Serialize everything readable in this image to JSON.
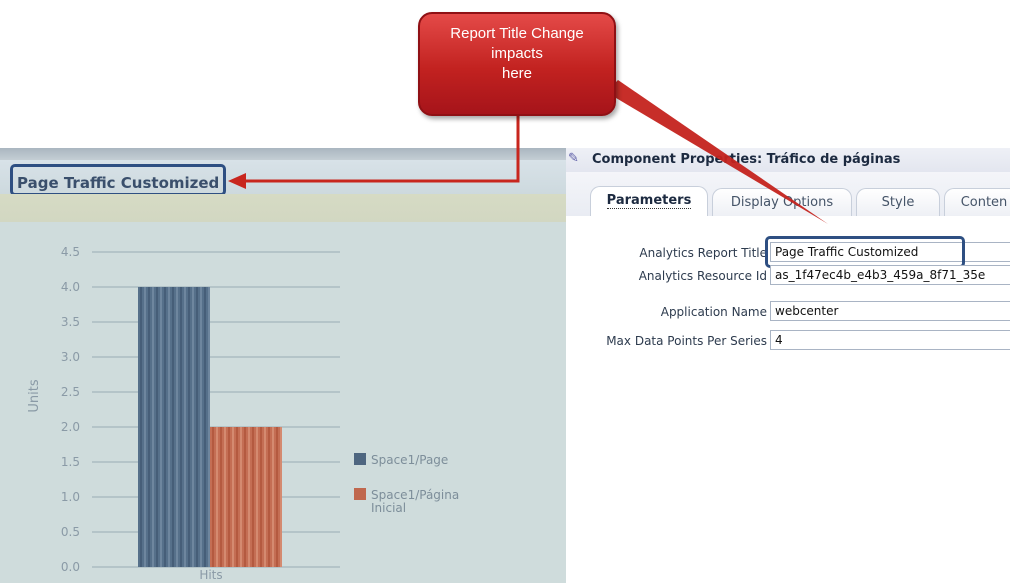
{
  "callout": {
    "lines": [
      "Report Title Change",
      "impacts",
      "here"
    ]
  },
  "report": {
    "title": "Page Traffic Customized"
  },
  "colors": {
    "series1": "#4e6680",
    "series2": "#c0684e",
    "callout": "#c22220",
    "highlight": "#2e4f82",
    "arrow": "#c8261e"
  },
  "chart_data": {
    "type": "bar",
    "categories": [
      "Hits"
    ],
    "series": [
      {
        "name": "Space1/Page",
        "values": [
          4.0
        ]
      },
      {
        "name": "Space1/Página Inicial",
        "values": [
          2.0
        ]
      }
    ],
    "ylabel": "Units",
    "xlabel": "",
    "ylim": [
      0,
      4.5
    ],
    "yticks": [
      "0.0",
      "0.5",
      "1.0",
      "1.5",
      "2.0",
      "2.5",
      "3.0",
      "3.5",
      "4.0",
      "4.5"
    ],
    "legend_placement": "right",
    "legend_labels": [
      [
        "Space1/Page"
      ],
      [
        "Space1/Página",
        "Inicial"
      ]
    ],
    "grid": true
  },
  "properties": {
    "icon": "component-properties-icon",
    "title": "Component Properties: Tráfico de páginas",
    "tabs": [
      {
        "label": "Parameters",
        "active": true
      },
      {
        "label": "Display Options",
        "active": false
      },
      {
        "label": "Style",
        "active": false
      },
      {
        "label": "Conten",
        "active": false
      }
    ],
    "fields": [
      {
        "label": "Analytics Report Title",
        "value": "Page Traffic Customized"
      },
      {
        "label": "Analytics Resource Id",
        "value": "as_1f47ec4b_e4b3_459a_8f71_35e"
      },
      {
        "label": "Application Name",
        "value": "webcenter"
      },
      {
        "label": "Max Data Points Per Series",
        "value": "4"
      }
    ]
  }
}
